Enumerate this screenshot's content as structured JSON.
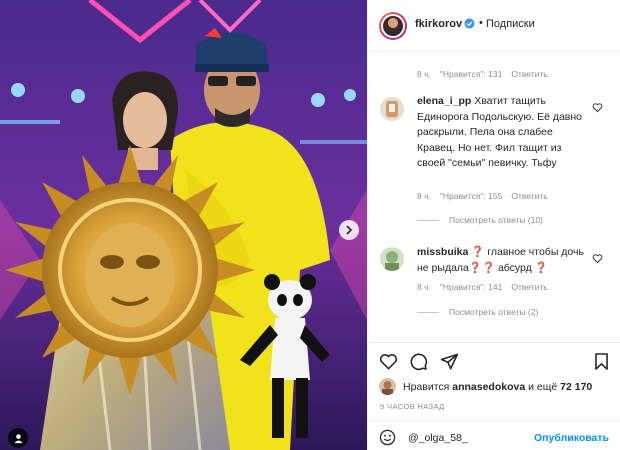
{
  "post": {
    "username": "fkirkorov",
    "follow_dot": "•",
    "follow_label": "Подписки"
  },
  "top_meta": {
    "time": "8 ч.",
    "likes": "\"Нравится\": 131",
    "reply": "Ответить"
  },
  "comments": [
    {
      "username": "elena_i_pp",
      "text": "Хватит тащить Единорога Подольскую. Её давно раскрыли. Пела она слабее Кравец. Но нет. Фил тащит из своей \"семьи\" певичку. Тьфу",
      "time": "8 ч.",
      "likes": "\"Нравится\": 155",
      "reply": "Ответить",
      "view_replies": "Посмотреть ответы (10)"
    },
    {
      "username": "missbuika",
      "text": "❓ главное чтобы дочь не рыдала❓❓ абсурд ❓",
      "time": "8 ч.",
      "likes": "\"Нравится\": 141",
      "reply": "Ответить",
      "view_replies": "Посмотреть ответы (2)"
    }
  ],
  "liked_by": {
    "prefix": "Нравится ",
    "user": "annasedokova",
    "suffix": " и ещё ",
    "count": "72 170"
  },
  "timestamp": "9 часов назад",
  "reply_input": {
    "value": "@_olga_58_",
    "publish_label": "Опубликовать"
  },
  "icons": {
    "like": "heart-icon",
    "comment": "comment-icon",
    "share": "share-icon",
    "save": "bookmark-icon",
    "emoji": "emoji-icon",
    "verified": "verified-badge-icon",
    "next": "chevron-right-icon",
    "tag": "user-tag-icon"
  },
  "colors": {
    "accent": "#0095f6",
    "verified": "#3897f0",
    "muted": "#8e8e8e"
  }
}
